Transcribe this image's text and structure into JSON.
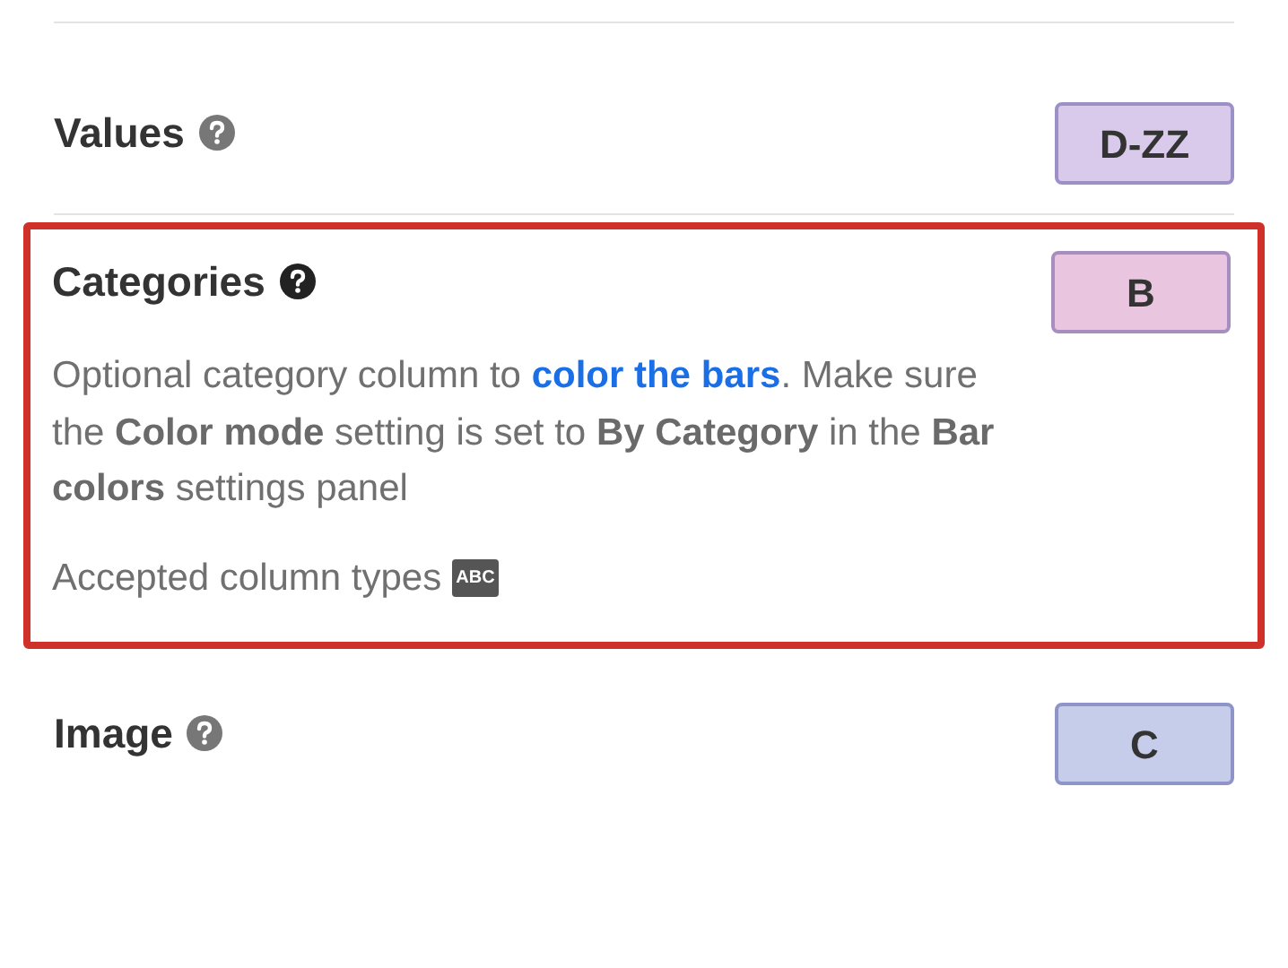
{
  "fields": [
    {
      "label": "Values",
      "selected": false,
      "badge": "D-ZZ",
      "color": "#d9c9ea"
    },
    {
      "label": "Categories",
      "selected": true,
      "badge": "B",
      "color": "#eac5df",
      "description": [
        {
          "kind": "text",
          "text": "Optional category column to "
        },
        {
          "kind": "link",
          "text": "color the bars"
        },
        {
          "kind": "text",
          "text": ". Make sure the **Color mode** setting is set to **By Category** in the **Bar colors** settings panel"
        }
      ],
      "accepted_label": "Accepted column types",
      "accepted_types": [
        "ABC"
      ]
    },
    {
      "label": "Image",
      "selected": false,
      "badge": "C",
      "color": "#c5cdea"
    }
  ]
}
